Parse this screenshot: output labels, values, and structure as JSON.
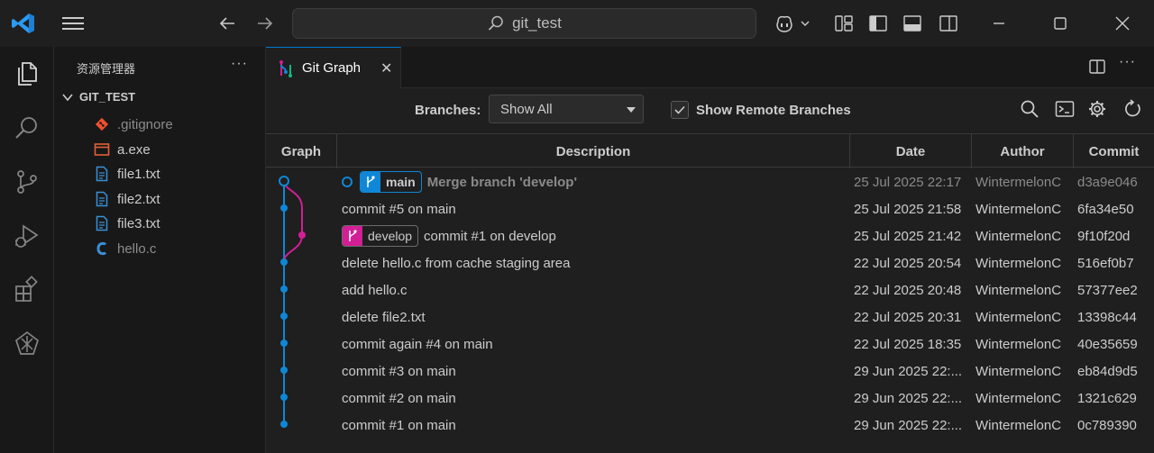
{
  "titlebar": {
    "search_text": "git_test"
  },
  "sidebar": {
    "title": "资源管理器",
    "more": "···",
    "folder": "GIT_TEST",
    "files": [
      {
        "name": ".gitignore",
        "icon": "git-icon",
        "color": "#f1502f"
      },
      {
        "name": "a.exe",
        "icon": "window-icon",
        "color": "#e0613a"
      },
      {
        "name": "file1.txt",
        "icon": "text-file-icon",
        "color": "#3a8fd6"
      },
      {
        "name": "file2.txt",
        "icon": "text-file-icon",
        "color": "#3a8fd6"
      },
      {
        "name": "file3.txt",
        "icon": "text-file-icon",
        "color": "#3a8fd6"
      },
      {
        "name": "hello.c",
        "icon": "c-file-icon",
        "color": "#3a8fd6"
      }
    ]
  },
  "tabs": {
    "active_label": "Git Graph",
    "close": "✕",
    "more": "···"
  },
  "controls": {
    "branches_label": "Branches:",
    "branches_value": "Show All",
    "show_remote_label": "Show Remote Branches",
    "show_remote_checked": true
  },
  "table": {
    "headers": {
      "graph": "Graph",
      "description": "Description",
      "date": "Date",
      "author": "Author",
      "commit": "Commit"
    },
    "rows": [
      {
        "description": "Merge branch 'develop'",
        "date": "25 Jul 2025 22:17",
        "author": "WintermelonC",
        "commit": "d3a9e046"
      },
      {
        "description": "commit #5 on main",
        "date": "25 Jul 2025 21:58",
        "author": "WintermelonC",
        "commit": "6fa34e50"
      },
      {
        "description": "commit #1 on develop",
        "date": "25 Jul 2025 21:42",
        "author": "WintermelonC",
        "commit": "9f10f20d"
      },
      {
        "description": "delete hello.c from cache staging area",
        "date": "22 Jul 2025 20:54",
        "author": "WintermelonC",
        "commit": "516ef0b7"
      },
      {
        "description": "add hello.c",
        "date": "22 Jul 2025 20:48",
        "author": "WintermelonC",
        "commit": "57377ee2"
      },
      {
        "description": "delete file2.txt",
        "date": "22 Jul 2025 20:31",
        "author": "WintermelonC",
        "commit": "13398c44"
      },
      {
        "description": "commit again #4 on main",
        "date": "22 Jul 2025 18:35",
        "author": "WintermelonC",
        "commit": "40e35659"
      },
      {
        "description": "commit #3 on main",
        "date": "29 Jun 2025 22:...",
        "author": "WintermelonC",
        "commit": "eb84d9d5"
      },
      {
        "description": "commit #2 on main",
        "date": "29 Jun 2025 22:...",
        "author": "WintermelonC",
        "commit": "1321c629"
      },
      {
        "description": "commit #1 on main",
        "date": "29 Jun 2025 22:...",
        "author": "WintermelonC",
        "commit": "0c789390"
      }
    ],
    "branch_labels": {
      "main": "main",
      "develop": "develop"
    }
  },
  "colors": {
    "accent": "#0078d4",
    "main_branch": "#0f87d6",
    "develop_branch": "#d21f95"
  }
}
